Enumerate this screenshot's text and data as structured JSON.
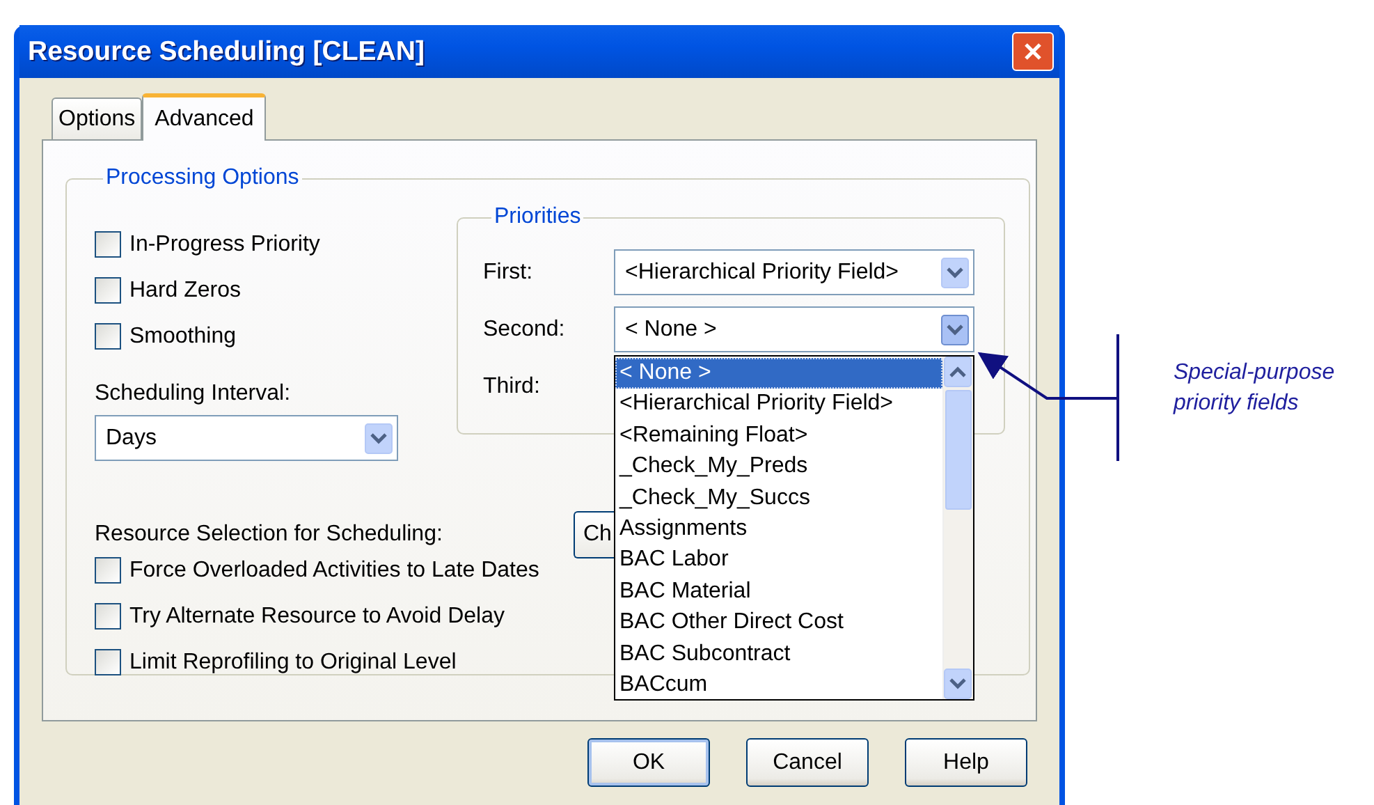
{
  "window": {
    "title": "Resource Scheduling [CLEAN]"
  },
  "tabs": [
    {
      "label": "Options",
      "selected": false
    },
    {
      "label": "Advanced",
      "selected": true
    }
  ],
  "processing_options": {
    "title": "Processing Options",
    "checkboxes": [
      {
        "label": "In-Progress Priority",
        "checked": false
      },
      {
        "label": "Hard Zeros",
        "checked": false
      },
      {
        "label": "Smoothing",
        "checked": false
      }
    ],
    "scheduling_interval": {
      "label": "Scheduling Interval:",
      "value": "Days"
    },
    "resource_selection": {
      "label": "Resource Selection for Scheduling:",
      "button": "Ch"
    },
    "more_checkboxes": [
      {
        "label": "Force Overloaded Activities to Late Dates",
        "checked": false
      },
      {
        "label": "Try Alternate Resource to Avoid Delay",
        "checked": false
      },
      {
        "label": "Limit Reprofiling to Original Level",
        "checked": false
      }
    ]
  },
  "priorities": {
    "title": "Priorities",
    "fields": [
      {
        "label": "First:",
        "value": "<Hierarchical Priority Field>",
        "open": false
      },
      {
        "label": "Second:",
        "value": "< None >",
        "open": true
      },
      {
        "label": "Third:"
      }
    ]
  },
  "dropdown_items": [
    {
      "label": "< None >",
      "selected": true
    },
    {
      "label": "<Hierarchical Priority Field>",
      "selected": false
    },
    {
      "label": "<Remaining Float>",
      "selected": false
    },
    {
      "label": "_Check_My_Preds",
      "selected": false
    },
    {
      "label": "_Check_My_Succs",
      "selected": false
    },
    {
      "label": "Assignments",
      "selected": false
    },
    {
      "label": "BAC Labor",
      "selected": false
    },
    {
      "label": "BAC Material",
      "selected": false
    },
    {
      "label": "BAC Other Direct Cost",
      "selected": false
    },
    {
      "label": "BAC Subcontract",
      "selected": false
    },
    {
      "label": "BACcum",
      "selected": false
    }
  ],
  "buttons": [
    {
      "label": "OK",
      "default": true
    },
    {
      "label": "Cancel",
      "default": false
    },
    {
      "label": "Help",
      "default": false
    }
  ],
  "annotation": {
    "text": "Special-purpose priority fields"
  }
}
